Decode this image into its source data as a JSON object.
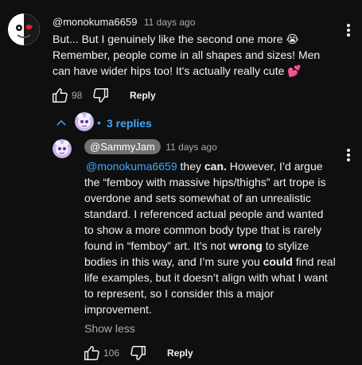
{
  "comment": {
    "author": "@monokuma6659",
    "time": "11 days ago",
    "line1": "But... But I genuinely like the second one more 😭",
    "line2": "Remember, people come in all shapes and sizes! Men",
    "line3": "can have wider hips too! It's actually really cute 💕",
    "likes": "98",
    "reply_label": "Reply",
    "replies_label": "3 replies",
    "separator": "•"
  },
  "reply": {
    "author": "@SammyJam",
    "time": "11 days ago",
    "mention": "@monokuma6659",
    "p1": " they ",
    "p1_bold": "can.",
    "p2": " However, I’d argue",
    "line2": "the “femboy with massive hips/thighs” art trope is",
    "line3": "overdone and sets somewhat of an unrealistic",
    "line4": "standard. I referenced actual people and wanted",
    "line5": "to show a more common body type that is rarely",
    "line6a": "found in “femboy” art. It’s not ",
    "line6_bold": "wrong",
    "line6b": " to stylize",
    "line7a": "bodies in this way, and I’m sure you ",
    "line7_bold": "could",
    "line7b": " find real",
    "line8": "life examples, but it doesn’t align with what I want",
    "line9": "to represent, so I consider this a major",
    "line10": "improvement.",
    "show_less": "Show less",
    "likes": "106",
    "reply_label": "Reply"
  },
  "colors": {
    "background": "#0f0f0f",
    "link_blue": "#3ea6ff",
    "chip_gray": "#717171",
    "secondary_text": "#aaaaaa"
  },
  "icons": [
    "monokuma-avatar-icon",
    "sammyjam-avatar-icon",
    "like-icon",
    "dislike-icon",
    "kebab-menu-icon",
    "chevron-up-icon"
  ]
}
